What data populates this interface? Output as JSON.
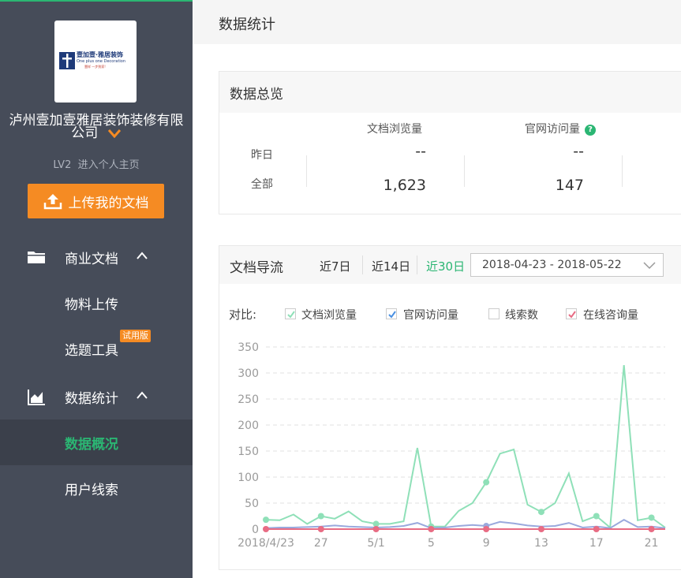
{
  "sidebar": {
    "logo": {
      "title": "壹加壹·雅居装饰",
      "subtitle": "One plus one Decoration",
      "tagline": "壹样 一步到家!"
    },
    "company_line1": "泸州壹加壹雅居装饰装修有限",
    "company_line2": "公司",
    "level": "LV2",
    "profile_link": "进入个人主页",
    "upload_label": "上传我的文档",
    "groups": [
      {
        "label": "商业文档",
        "items": [
          "物料上传",
          "选题工具"
        ]
      },
      {
        "label": "数据统计",
        "items": [
          "数据概况",
          "用户线索"
        ]
      }
    ],
    "trial_badge": "试用版",
    "colors": {
      "bg": "#464c59",
      "accent": "#2bb673",
      "orange": "#f58b23"
    }
  },
  "page": {
    "title": "数据统计"
  },
  "overview": {
    "title": "数据总览",
    "columns": [
      "文档浏览量",
      "官网访问量"
    ],
    "rows": [
      {
        "label": "昨日",
        "values": [
          "--",
          "--"
        ]
      },
      {
        "label": "全部",
        "values": [
          "1,623",
          "147"
        ]
      }
    ]
  },
  "flow": {
    "title": "文档导流",
    "ranges": [
      "近7日",
      "近14日",
      "近30日"
    ],
    "active_range": "近30日",
    "date_range": "2018-04-23 - 2018-05-22",
    "compare_label": "对比:",
    "legend": [
      {
        "name": "文档浏览量",
        "checked": true,
        "color": "#8fe0b8"
      },
      {
        "name": "官网访问量",
        "checked": true,
        "color": "#4a90e2"
      },
      {
        "name": "线索数",
        "checked": false,
        "color": "#cccccc"
      },
      {
        "name": "在线咨询量",
        "checked": true,
        "color": "#e86c84"
      }
    ]
  },
  "chart_data": {
    "type": "line",
    "ylim": [
      0,
      350
    ],
    "yticks": [
      "0",
      "50",
      "100",
      "150",
      "200",
      "250",
      "300",
      "350"
    ],
    "xtick_labels": [
      "2018/4/23",
      "27",
      "5/1",
      "5",
      "9",
      "13",
      "17",
      "21"
    ],
    "xtick_index": [
      0,
      4,
      8,
      12,
      16,
      20,
      24,
      28
    ],
    "n_points": 30,
    "grid": true,
    "series": [
      {
        "name": "文档浏览量",
        "color": "#8fe0b8",
        "values": [
          18,
          17,
          28,
          10,
          25,
          20,
          34,
          15,
          10,
          10,
          15,
          156,
          5,
          5,
          35,
          50,
          90,
          145,
          153,
          47,
          33,
          50,
          107,
          15,
          25,
          3,
          315,
          17,
          22,
          3
        ],
        "markers": [
          0,
          4,
          8,
          12,
          16,
          20,
          24,
          28
        ]
      },
      {
        "name": "官网访问量",
        "color": "#9aa9dd",
        "values": [
          2,
          3,
          3,
          4,
          5,
          7,
          5,
          4,
          3,
          4,
          6,
          12,
          2,
          3,
          6,
          8,
          6,
          14,
          11,
          7,
          5,
          6,
          12,
          3,
          5,
          2,
          18,
          4,
          5,
          2
        ],
        "markers": [
          16
        ]
      },
      {
        "name": "在线咨询量",
        "color": "#e86c84",
        "values": [
          0,
          0,
          0,
          0,
          0,
          0,
          0,
          0,
          0,
          0,
          0,
          0,
          0,
          0,
          0,
          0,
          0,
          0,
          0,
          0,
          0,
          0,
          0,
          0,
          0,
          0,
          0,
          0,
          0,
          0
        ],
        "markers": [
          0,
          4,
          8,
          12,
          16,
          20,
          24,
          28
        ]
      }
    ]
  }
}
